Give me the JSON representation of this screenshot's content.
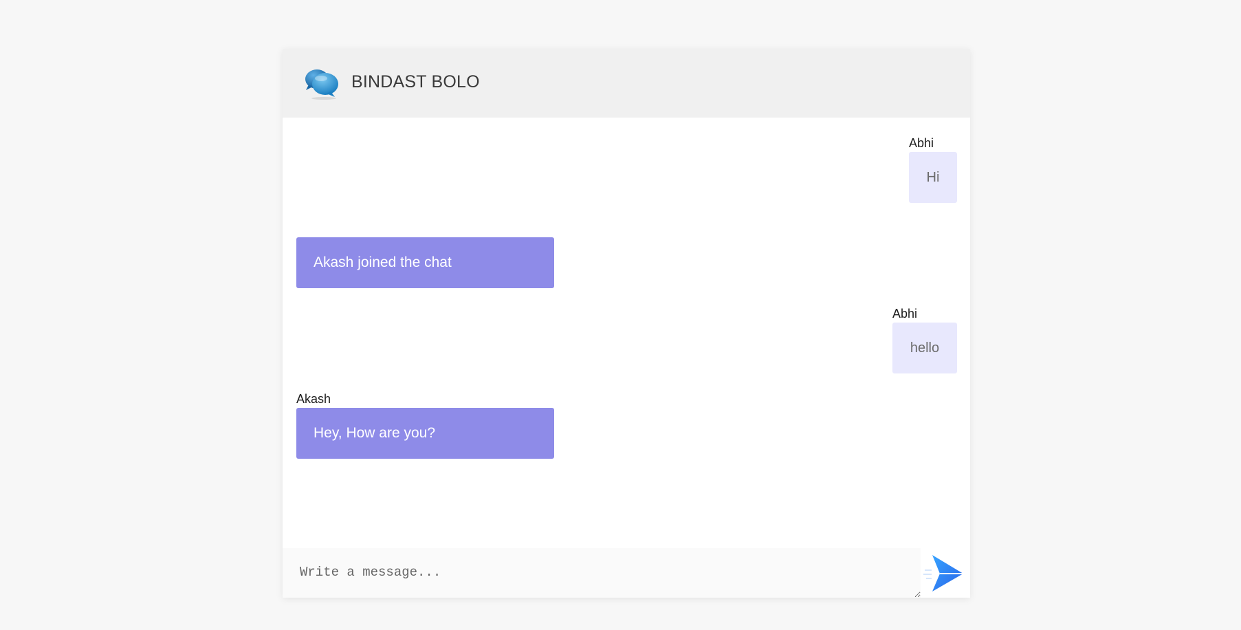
{
  "header": {
    "logo_icon": "chat-bubbles-logo-icon",
    "title": "BINDAST BOLO"
  },
  "messages": [
    {
      "type": "outgoing",
      "sender": "Abhi",
      "text": "Hi"
    },
    {
      "type": "system",
      "text": "Akash joined the chat"
    },
    {
      "type": "outgoing",
      "sender": "Abhi",
      "text": "hello"
    },
    {
      "type": "incoming",
      "sender": "Akash",
      "text": "Hey, How are you?"
    }
  ],
  "composer": {
    "placeholder": "Write a message...",
    "send_icon": "paper-plane-send-icon"
  },
  "colors": {
    "header_bg": "#f0f0f0",
    "outgoing_bubble": "#e8e8fd",
    "incoming_bubble": "#8e8be8",
    "send_accent": "#2f7cf6"
  }
}
